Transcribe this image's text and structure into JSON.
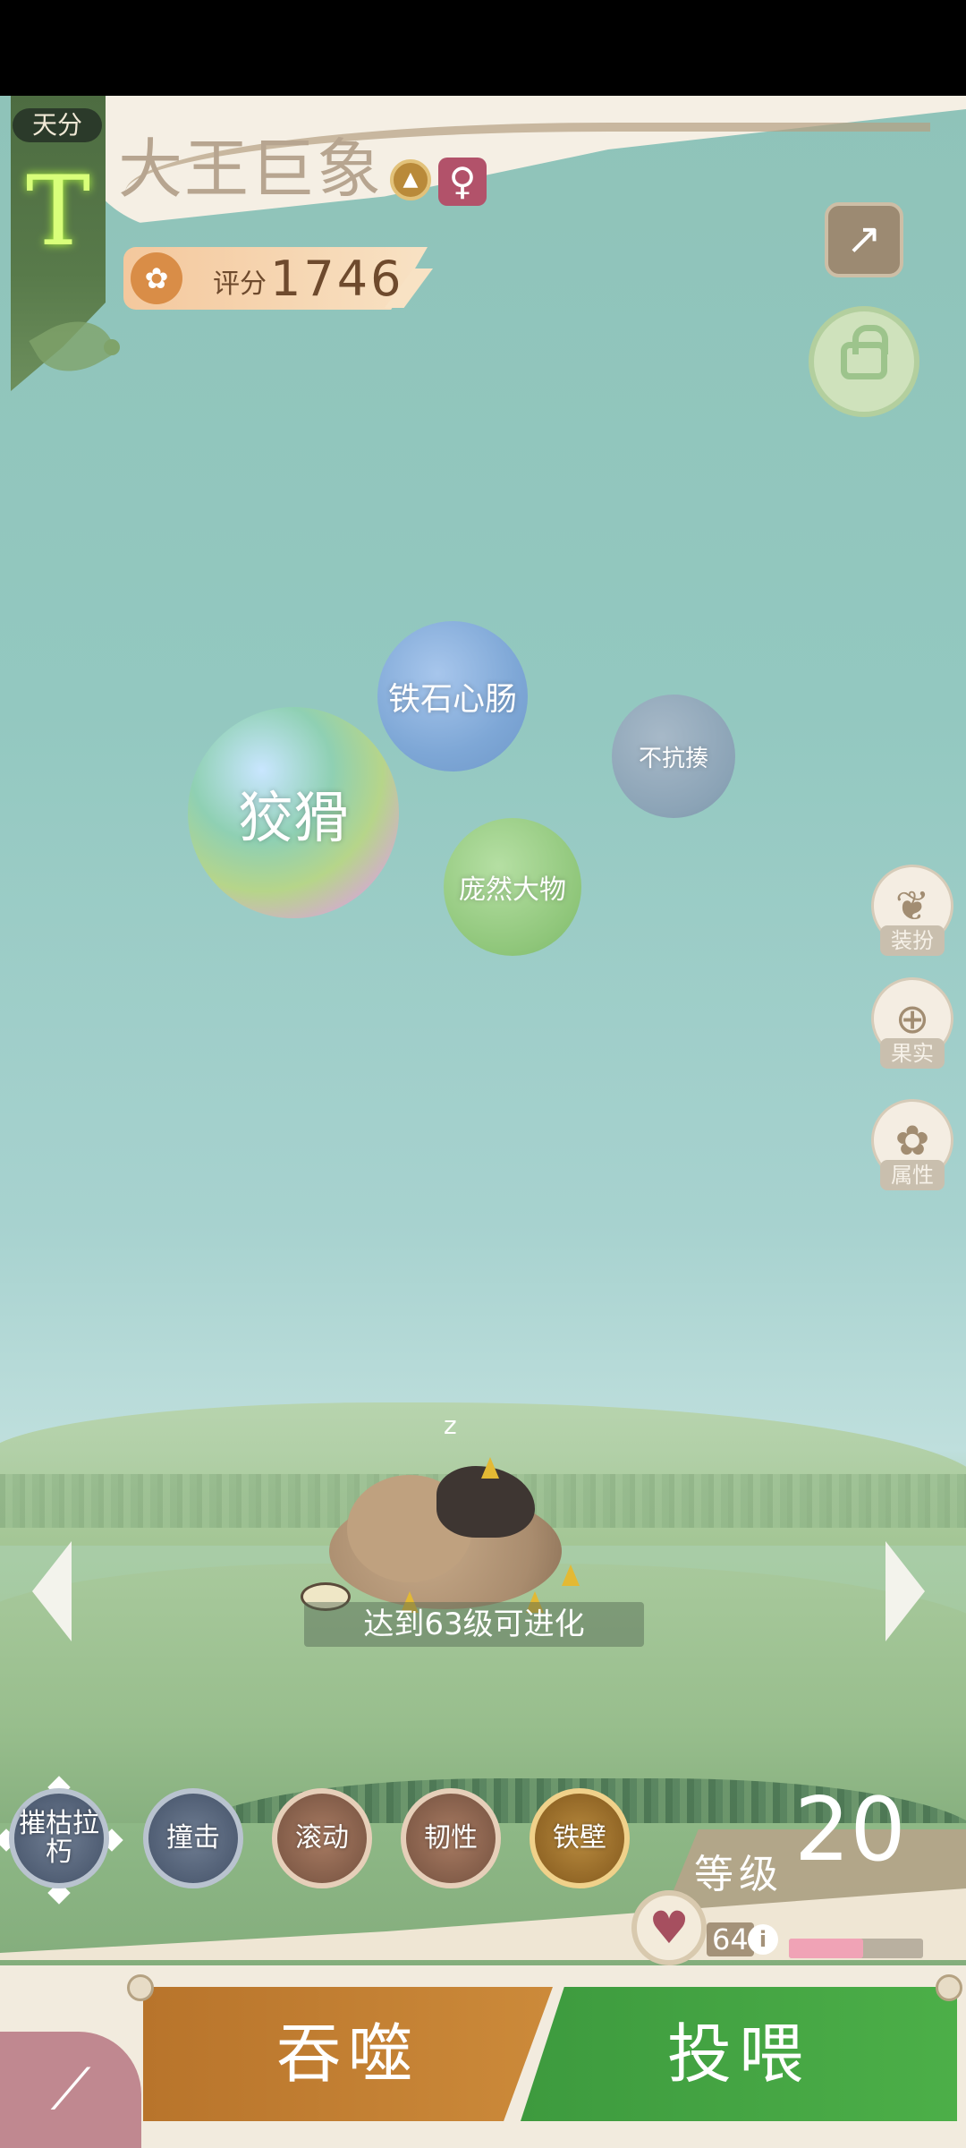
{
  "header": {
    "tier_tag": "天分",
    "tier_grade": "T",
    "pet_name": "大王巨象",
    "gender_symbol": "♀",
    "score_label": "评分",
    "score_value": "1746"
  },
  "traits": [
    {
      "label": "狡猾"
    },
    {
      "label": "铁石心肠"
    },
    {
      "label": "不抗揍"
    },
    {
      "label": "庞然大物"
    }
  ],
  "side_menu": {
    "dress_label": "装扮",
    "fruit_label": "果实",
    "attributes_label": "属性"
  },
  "pet": {
    "sleep_mark": "z",
    "evolve_hint": "达到63级可进化"
  },
  "skills": [
    {
      "label": "摧枯拉朽"
    },
    {
      "label": "撞击"
    },
    {
      "label": "滚动"
    },
    {
      "label": "韧性"
    },
    {
      "label": "铁壁"
    }
  ],
  "level": {
    "label": "等级",
    "value": "20"
  },
  "affection": {
    "value": "64",
    "info_icon": "i",
    "fill_fraction": 0.55
  },
  "actions": {
    "devour_label": "吞噬",
    "feed_label": "投喂"
  },
  "colors": {
    "devour": "#c07f33",
    "feed": "#45a444",
    "tier_glow": "#d9ff7a",
    "affection_fill": "#f0a3b6"
  }
}
